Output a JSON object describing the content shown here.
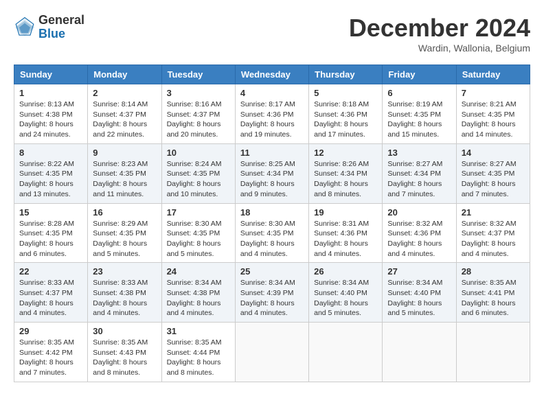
{
  "header": {
    "logo_general": "General",
    "logo_blue": "Blue",
    "month_title": "December 2024",
    "subtitle": "Wardin, Wallonia, Belgium"
  },
  "days_of_week": [
    "Sunday",
    "Monday",
    "Tuesday",
    "Wednesday",
    "Thursday",
    "Friday",
    "Saturday"
  ],
  "weeks": [
    [
      {
        "day": "1",
        "sunrise": "8:13 AM",
        "sunset": "4:38 PM",
        "daylight": "8 hours and 24 minutes."
      },
      {
        "day": "2",
        "sunrise": "8:14 AM",
        "sunset": "4:37 PM",
        "daylight": "8 hours and 22 minutes."
      },
      {
        "day": "3",
        "sunrise": "8:16 AM",
        "sunset": "4:37 PM",
        "daylight": "8 hours and 20 minutes."
      },
      {
        "day": "4",
        "sunrise": "8:17 AM",
        "sunset": "4:36 PM",
        "daylight": "8 hours and 19 minutes."
      },
      {
        "day": "5",
        "sunrise": "8:18 AM",
        "sunset": "4:36 PM",
        "daylight": "8 hours and 17 minutes."
      },
      {
        "day": "6",
        "sunrise": "8:19 AM",
        "sunset": "4:35 PM",
        "daylight": "8 hours and 15 minutes."
      },
      {
        "day": "7",
        "sunrise": "8:21 AM",
        "sunset": "4:35 PM",
        "daylight": "8 hours and 14 minutes."
      }
    ],
    [
      {
        "day": "8",
        "sunrise": "8:22 AM",
        "sunset": "4:35 PM",
        "daylight": "8 hours and 13 minutes."
      },
      {
        "day": "9",
        "sunrise": "8:23 AM",
        "sunset": "4:35 PM",
        "daylight": "8 hours and 11 minutes."
      },
      {
        "day": "10",
        "sunrise": "8:24 AM",
        "sunset": "4:35 PM",
        "daylight": "8 hours and 10 minutes."
      },
      {
        "day": "11",
        "sunrise": "8:25 AM",
        "sunset": "4:34 PM",
        "daylight": "8 hours and 9 minutes."
      },
      {
        "day": "12",
        "sunrise": "8:26 AM",
        "sunset": "4:34 PM",
        "daylight": "8 hours and 8 minutes."
      },
      {
        "day": "13",
        "sunrise": "8:27 AM",
        "sunset": "4:34 PM",
        "daylight": "8 hours and 7 minutes."
      },
      {
        "day": "14",
        "sunrise": "8:27 AM",
        "sunset": "4:35 PM",
        "daylight": "8 hours and 7 minutes."
      }
    ],
    [
      {
        "day": "15",
        "sunrise": "8:28 AM",
        "sunset": "4:35 PM",
        "daylight": "8 hours and 6 minutes."
      },
      {
        "day": "16",
        "sunrise": "8:29 AM",
        "sunset": "4:35 PM",
        "daylight": "8 hours and 5 minutes."
      },
      {
        "day": "17",
        "sunrise": "8:30 AM",
        "sunset": "4:35 PM",
        "daylight": "8 hours and 5 minutes."
      },
      {
        "day": "18",
        "sunrise": "8:30 AM",
        "sunset": "4:35 PM",
        "daylight": "8 hours and 4 minutes."
      },
      {
        "day": "19",
        "sunrise": "8:31 AM",
        "sunset": "4:36 PM",
        "daylight": "8 hours and 4 minutes."
      },
      {
        "day": "20",
        "sunrise": "8:32 AM",
        "sunset": "4:36 PM",
        "daylight": "8 hours and 4 minutes."
      },
      {
        "day": "21",
        "sunrise": "8:32 AM",
        "sunset": "4:37 PM",
        "daylight": "8 hours and 4 minutes."
      }
    ],
    [
      {
        "day": "22",
        "sunrise": "8:33 AM",
        "sunset": "4:37 PM",
        "daylight": "8 hours and 4 minutes."
      },
      {
        "day": "23",
        "sunrise": "8:33 AM",
        "sunset": "4:38 PM",
        "daylight": "8 hours and 4 minutes."
      },
      {
        "day": "24",
        "sunrise": "8:34 AM",
        "sunset": "4:38 PM",
        "daylight": "8 hours and 4 minutes."
      },
      {
        "day": "25",
        "sunrise": "8:34 AM",
        "sunset": "4:39 PM",
        "daylight": "8 hours and 4 minutes."
      },
      {
        "day": "26",
        "sunrise": "8:34 AM",
        "sunset": "4:40 PM",
        "daylight": "8 hours and 5 minutes."
      },
      {
        "day": "27",
        "sunrise": "8:34 AM",
        "sunset": "4:40 PM",
        "daylight": "8 hours and 5 minutes."
      },
      {
        "day": "28",
        "sunrise": "8:35 AM",
        "sunset": "4:41 PM",
        "daylight": "8 hours and 6 minutes."
      }
    ],
    [
      {
        "day": "29",
        "sunrise": "8:35 AM",
        "sunset": "4:42 PM",
        "daylight": "8 hours and 7 minutes."
      },
      {
        "day": "30",
        "sunrise": "8:35 AM",
        "sunset": "4:43 PM",
        "daylight": "8 hours and 8 minutes."
      },
      {
        "day": "31",
        "sunrise": "8:35 AM",
        "sunset": "4:44 PM",
        "daylight": "8 hours and 8 minutes."
      },
      null,
      null,
      null,
      null
    ]
  ],
  "labels": {
    "sunrise": "Sunrise:",
    "sunset": "Sunset:",
    "daylight": "Daylight:"
  }
}
